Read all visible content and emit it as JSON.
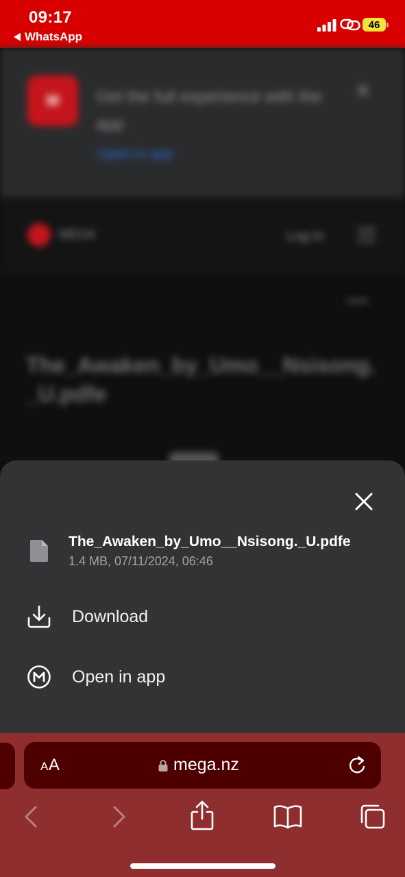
{
  "status_bar": {
    "time": "09:17",
    "back_app": "WhatsApp",
    "battery": "46"
  },
  "background_page": {
    "banner_logo": "M",
    "banner_text": "Get the full experience with the app",
    "banner_link": "Open in app",
    "site_name": "MEGA",
    "login": "Log in",
    "file_title": "The_Awaken_by_Umo__Nsisong._U.pdfe"
  },
  "sheet": {
    "file_name": "The_Awaken_by_Umo__Nsisong._U.pdfe",
    "file_meta": "1.4 MB, 07/11/2024, 06:46",
    "actions": [
      {
        "label": "Download",
        "icon": "download-icon"
      },
      {
        "label": "Open in app",
        "icon": "mega-logo-icon"
      }
    ]
  },
  "browser": {
    "text_size_small": "A",
    "text_size_large": "A",
    "url": "mega.nz"
  },
  "colors": {
    "status_bar": "#d90000",
    "sheet": "#323335",
    "browser_bar": "#8f2e2e",
    "address_bar": "#4e0000"
  }
}
